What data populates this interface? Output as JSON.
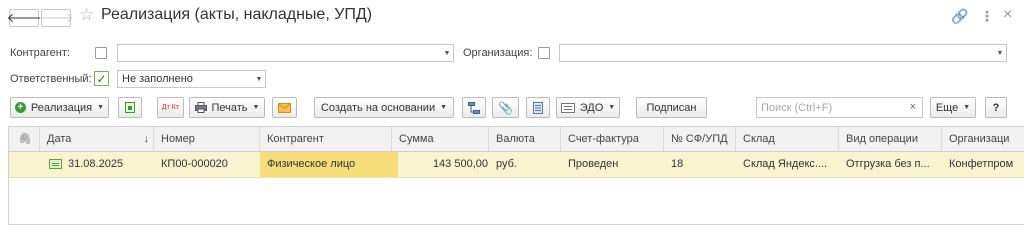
{
  "header": {
    "title": "Реализация (акты, накладные, УПД)",
    "back_glyph": "🡐",
    "forward_glyph": "🡒",
    "star_glyph": "☆",
    "link_glyph": "🔗",
    "more_glyph": "⋮",
    "close_glyph": "×"
  },
  "filters": {
    "counterparty_label": "Контрагент:",
    "counterparty_value": "",
    "organization_label": "Организация:",
    "organization_value": "",
    "responsible_label": "Ответственный:",
    "responsible_value": "Не заполнено",
    "responsible_checked": true
  },
  "toolbar": {
    "realization_label": "Реализация",
    "print_label": "Печать",
    "create_based_label": "Создать на основании",
    "edo_label": "ЭДО",
    "signed_label": "Подписан",
    "search_placeholder": "Поиск (Ctrl+F)",
    "more_label": "Еще",
    "help_label": "?",
    "dtkt_label": "Дт Кт",
    "accent_color": "#3c9a35"
  },
  "table": {
    "columns": [
      "Дата",
      "Номер",
      "Контрагент",
      "Сумма",
      "Валюта",
      "Счет-фактура",
      "№ СФ/УПД",
      "Склад",
      "Вид операции",
      "Организаци"
    ],
    "sort_indicator": "↓",
    "rows": [
      {
        "date": "31.08.2025",
        "number": "КП00-000020",
        "counterparty": "Физическое лицо",
        "sum": "143 500,00",
        "currency": "руб.",
        "invoice": "Проведен",
        "invoice_number": "18",
        "warehouse": "Склад Яндекс....",
        "operation": "Отгрузка без п...",
        "organization": "Конфетпром"
      }
    ],
    "selected_row_color": "#faf3d0",
    "selected_cell_color": "#f7dc7a"
  }
}
